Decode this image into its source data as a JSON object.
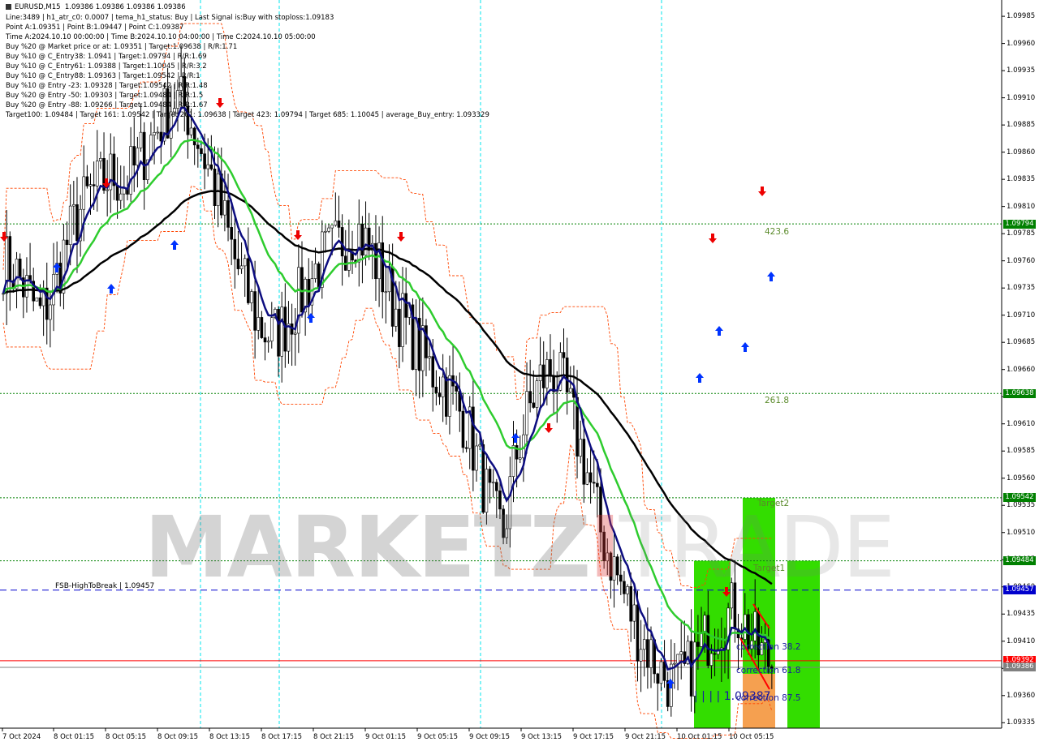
{
  "header": {
    "symbol": "EURUSD,M15",
    "ohlc": "1.09386 1.09386 1.09386 1.09386",
    "lines": [
      "Line:3489  |  h1_atr_c0: 0.0007  |  tema_h1_status: Buy  |  Last Signal is:Buy with stoploss:1.09183",
      "Point A:1.09351  |  Point B:1.09447  |  Point C:1.09387",
      "Time A:2024.10.10 00:00:00  |  Time B:2024.10.10 04:00:00  |  Time C:2024.10.10 05:00:00",
      "Buy %20 @ Market price or at: 1.09351  |  Target:1.09638  |  R/R:1.71",
      "Buy %10 @ C_Entry38: 1.0941  |  Target:1.09794  |  R/R:1.69",
      "Buy %10 @ C_Entry61: 1.09388  |  Target:1.10045  |  R/R:3.2",
      "Buy %10 @ C_Entry88: 1.09363  |  Target:1.09542  |  R/R:1",
      "Buy %10 @ Entry -23: 1.09328  |  Target:1.09542  |  R/R:1.48",
      "Buy %20 @ Entry -50: 1.09303  |  Target:1.09484  |  R/R:1.5",
      "Buy %20 @ Entry -88: 1.09266  |  Target:1.09484  |  R/R:1.67",
      "Target100: 1.09484  |  Target 161: 1.09542  |  Target 261: 1.09638  |  Target 423: 1.09794  |  Target 685: 1.10045  |  average_Buy_entry: 1.093329"
    ]
  },
  "colors": {
    "ema_black": "#000000",
    "ema_navy": "#0d0d80",
    "ema_green": "#2ecc2e",
    "band_orange": "#ff4500",
    "level_green": "#008000",
    "fsb_blue": "#0000cd",
    "bid_red": "#ff0000",
    "zone_green": "#33dd00",
    "zone_orange": "#f5a050"
  },
  "watermark": {
    "main": "MARKETZ",
    "accent": "I",
    "light": "TRADE"
  },
  "annotations": {
    "fsb": "FSB-HighToBreak  |  1.09457",
    "t423": "423.6",
    "t261": "261.8",
    "target2": "Target2",
    "target1": "Target1",
    "corr382": "correction 38.2",
    "corr618": "correction 61.8",
    "corr875": "correction 87.5",
    "bottom_value": "| | | | 1.09387"
  },
  "chart_data": {
    "type": "candlestick",
    "symbol": "EURUSD",
    "timeframe": "M15",
    "y_axis": {
      "range": [
        1.0933,
        1.1
      ],
      "ticks": [
        "1.09985",
        "1.09960",
        "1.09935",
        "1.09910",
        "1.09885",
        "1.09860",
        "1.09835",
        "1.09810",
        "1.09785",
        "1.09760",
        "1.09735",
        "1.09710",
        "1.09685",
        "1.09660",
        "1.09635",
        "1.09610",
        "1.09585",
        "1.09560",
        "1.09535",
        "1.09510",
        "1.09485",
        "1.09460",
        "1.09435",
        "1.09410",
        "1.09385",
        "1.09360",
        "1.09335"
      ]
    },
    "x_axis": {
      "ticks": [
        "7 Oct 2024",
        "8 Oct 01:15",
        "8 Oct 05:15",
        "8 Oct 09:15",
        "8 Oct 13:15",
        "8 Oct 17:15",
        "8 Oct 21:15",
        "9 Oct 01:15",
        "9 Oct 05:15",
        "9 Oct 09:15",
        "9 Oct 13:15",
        "9 Oct 17:15",
        "9 Oct 21:15",
        "10 Oct 01:15",
        "10 Oct 05:15"
      ]
    },
    "levels": [
      {
        "price": 1.09794,
        "label": "1.09794",
        "style": "dotted",
        "color": "#008000"
      },
      {
        "price": 1.09638,
        "label": "1.09638",
        "style": "dotted",
        "color": "#008000"
      },
      {
        "price": 1.09542,
        "label": "1.09542",
        "style": "dotted",
        "color": "#008000"
      },
      {
        "price": 1.09484,
        "label": "1.09484",
        "style": "dotted",
        "color": "#008000"
      },
      {
        "price": 1.09457,
        "label": "1.09457",
        "style": "dashed",
        "color": "#0000cd"
      },
      {
        "price": 1.09392,
        "label": "1.09392",
        "style": "solid",
        "color": "#ff0000"
      },
      {
        "price": 1.09386,
        "label": "1.09386",
        "style": "solid",
        "color": "#808080"
      }
    ],
    "close_series_approx": [
      1.0976,
      1.0975,
      1.0973,
      1.0971,
      1.0973,
      1.0977,
      1.098,
      1.0982,
      1.0983,
      1.0984,
      1.0983,
      1.0985,
      1.0987,
      1.0989,
      1.0991,
      1.099,
      1.0987,
      1.0984,
      1.098,
      1.0976,
      1.0973,
      1.097,
      1.0969,
      1.097,
      1.0972,
      1.0974,
      1.0976,
      1.0977,
      1.0978,
      1.0979,
      1.0977,
      1.0975,
      1.0972,
      1.097,
      1.0968,
      1.0966,
      1.0965,
      1.0963,
      1.0961,
      1.0957,
      1.0953,
      1.0951,
      1.0958,
      1.0962,
      1.0965,
      1.0966,
      1.0964,
      1.096,
      1.0956,
      1.0951,
      1.0948,
      1.0945,
      1.0942,
      1.094,
      1.0938,
      1.0937,
      1.0938,
      1.094,
      1.0942,
      1.0943,
      1.0944,
      1.0942,
      1.094,
      1.0939
    ]
  }
}
